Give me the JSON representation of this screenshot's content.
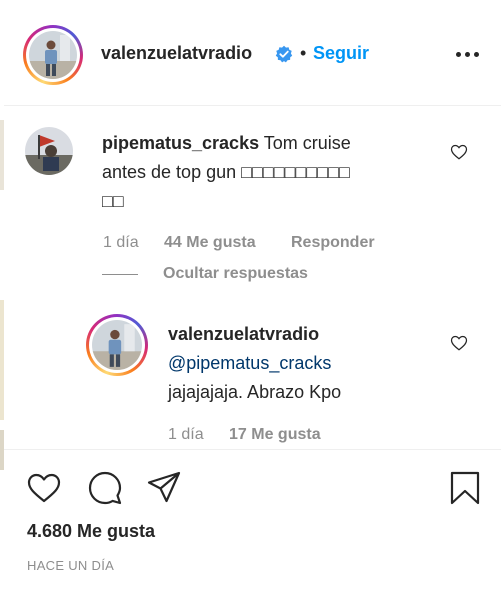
{
  "post": {
    "author": "valenzuelatvradio",
    "separator": "•",
    "follow_label": "Seguir",
    "more_icon": "more-horizontal-icon",
    "verified_icon": "verified-badge-icon"
  },
  "comments": [
    {
      "username": "pipematus_cracks",
      "text_line1": "Tom cruise",
      "text_line2": "antes de top gun □□□□□□□□□□",
      "text_line3": "□□",
      "time": "1 día",
      "likes": "44 Me gusta",
      "reply_label": "Responder",
      "like_icon": "heart-outline-icon"
    }
  ],
  "hide_replies_label": "Ocultar respuestas",
  "reply": {
    "username": "valenzuelatvradio",
    "mention": "@pipematus_cracks",
    "text": "jajajajaja. Abrazo Kpo",
    "time": "1 día",
    "likes": "17 Me gusta",
    "like_icon": "heart-outline-icon"
  },
  "actions": {
    "like_icon": "heart-outline-icon",
    "comment_icon": "comment-bubble-icon",
    "share_icon": "paper-plane-icon",
    "save_icon": "bookmark-icon",
    "likes_count": "4.680 Me gusta",
    "timestamp": "HACE UN DÍA"
  },
  "colors": {
    "link_blue": "#0095f6",
    "text": "#262626",
    "muted": "#8e8e8e",
    "mention": "#00376b"
  }
}
